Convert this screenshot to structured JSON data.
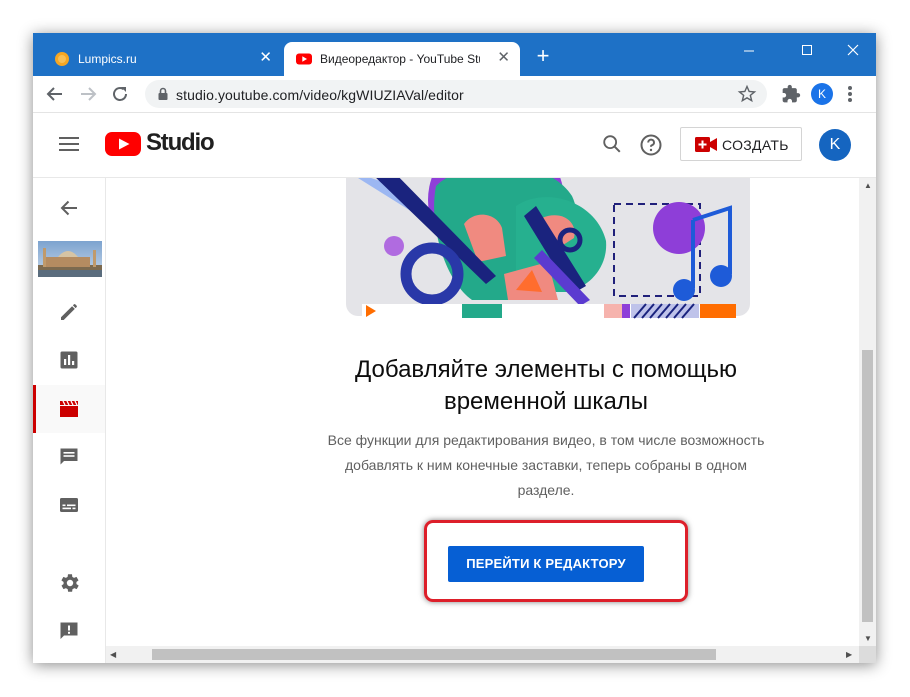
{
  "browser": {
    "tabs": [
      {
        "title": "Lumpics.ru",
        "favicon": "lumpics-orange-circle-icon",
        "active": false
      },
      {
        "title": "Видеоредактор - YouTube Studio",
        "favicon": "youtube-icon",
        "active": true
      }
    ],
    "close_glyph": "✕",
    "new_tab_glyph": "+",
    "url": "studio.youtube.com/video/kgWIUZIAVal/editor",
    "profile_initial": "K",
    "accent_color": "#1e71c6"
  },
  "studio": {
    "logo_text": "Studio",
    "create_label": "СОЗДАТЬ",
    "avatar_initial": "K",
    "brand_red": "#ff0000"
  },
  "sidebar": {
    "items": [
      {
        "name": "back-arrow-icon"
      },
      {
        "name": "video-thumbnail"
      },
      {
        "name": "edit-pencil-icon"
      },
      {
        "name": "analytics-icon"
      },
      {
        "name": "editor-clapperboard-icon",
        "active": true
      },
      {
        "name": "comments-icon"
      },
      {
        "name": "subtitles-icon"
      },
      {
        "name": "settings-gear-icon"
      },
      {
        "name": "feedback-icon"
      }
    ],
    "active_color": "#cc0000"
  },
  "main": {
    "heading": "Добавляйте элементы с помощью временной шкалы",
    "description": "Все функции для редактирования видео, в том числе возможность добавлять к ним конечные заставки, теперь собраны в одном разделе.",
    "button_label": "ПЕРЕЙТИ К РЕДАКТОРУ",
    "button_color": "#065fd4",
    "callout_color": "#dd1f2a"
  }
}
